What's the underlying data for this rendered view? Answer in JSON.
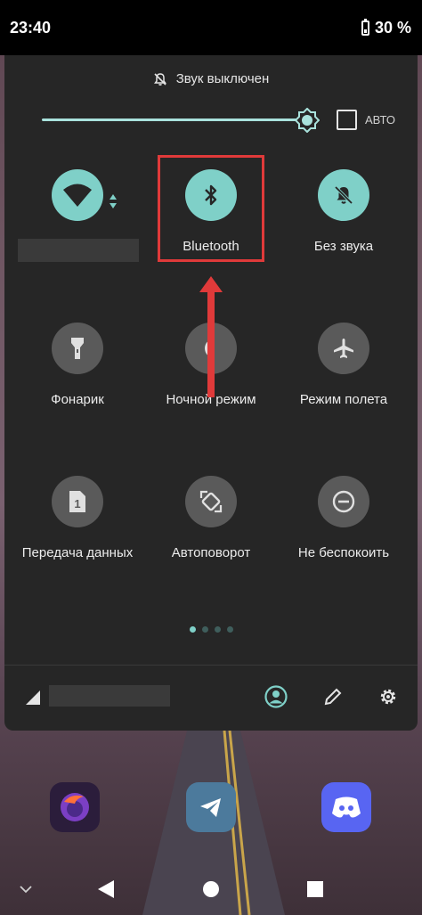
{
  "status_bar": {
    "time": "23:40",
    "battery": "30 %"
  },
  "quick_settings": {
    "sound_status": "Звук выключен",
    "brightness": {
      "level_fraction": 0.97
    },
    "auto_label": "АВТО",
    "tiles": [
      {
        "label": "",
        "icon": "wifi-icon",
        "state": "on"
      },
      {
        "label": "Bluetooth",
        "icon": "bluetooth-icon",
        "state": "on"
      },
      {
        "label": "Без звука",
        "icon": "bell-off-icon",
        "state": "on"
      },
      {
        "label": "Фонарик",
        "icon": "flashlight-icon",
        "state": "off"
      },
      {
        "label": "Ночной режим",
        "icon": "night-mode-icon",
        "state": "off"
      },
      {
        "label": "Режим полета",
        "icon": "airplane-icon",
        "state": "off"
      },
      {
        "label": "Передача данных",
        "icon": "sim-card-icon",
        "state": "off"
      },
      {
        "label": "Автоповорот",
        "icon": "auto-rotate-icon",
        "state": "off"
      },
      {
        "label": "Не беспокоить",
        "icon": "do-not-disturb-icon",
        "state": "off"
      }
    ],
    "pages": {
      "count": 4,
      "active": 0
    }
  },
  "colors": {
    "accent": "#7fd0c8",
    "highlight": "#e03a3a",
    "panel": "#262626"
  }
}
